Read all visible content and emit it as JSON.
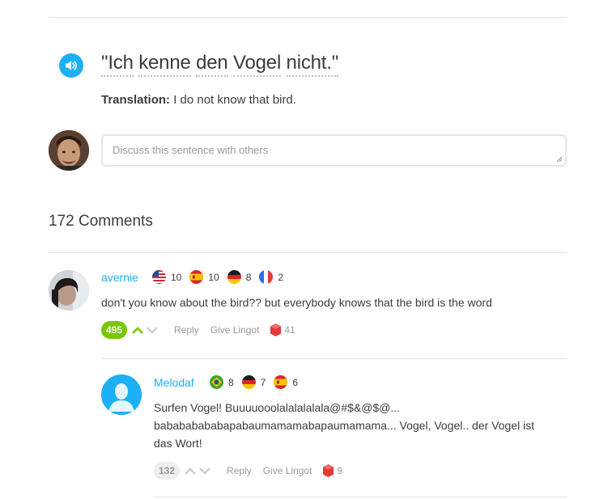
{
  "sentence": {
    "words": [
      "\"Ich",
      "kenne",
      "den",
      "Vogel",
      "nicht.\""
    ],
    "translation_label": "Translation:",
    "translation_text": "I do not know that bird."
  },
  "discuss": {
    "placeholder": "Discuss this sentence with others"
  },
  "comments_header": "172 Comments",
  "comments": [
    {
      "user": "avernie",
      "flags": [
        {
          "icon": "us-flag-icon",
          "level": "10"
        },
        {
          "icon": "spain-flag-icon",
          "level": "10"
        },
        {
          "icon": "germany-flag-icon",
          "level": "8"
        },
        {
          "icon": "france-flag-icon",
          "level": "2"
        }
      ],
      "text": "don't you know about the bird?? but everybody knows that the bird is the word",
      "score": "495",
      "reply": "Reply",
      "give_lingot": "Give Lingot",
      "lingots": "41"
    },
    {
      "user": "Melodaf",
      "flags": [
        {
          "icon": "brazil-flag-icon",
          "level": "8"
        },
        {
          "icon": "germany-flag-icon",
          "level": "7"
        },
        {
          "icon": "spain-flag-icon",
          "level": "6"
        }
      ],
      "text_lines": [
        "Surfen Vogel! Buuuuooolalalalalala@#$&@$@...",
        "babababababapabaumamamabapaumamama... Vogel, Vogel.. der Vogel ist",
        "das Wort!"
      ],
      "score": "132",
      "reply": "Reply",
      "give_lingot": "Give Lingot",
      "lingots": "9"
    }
  ],
  "colors": {
    "accent_blue": "#1cb0f6",
    "green": "#78c800",
    "lingot_red": "#e53838"
  }
}
